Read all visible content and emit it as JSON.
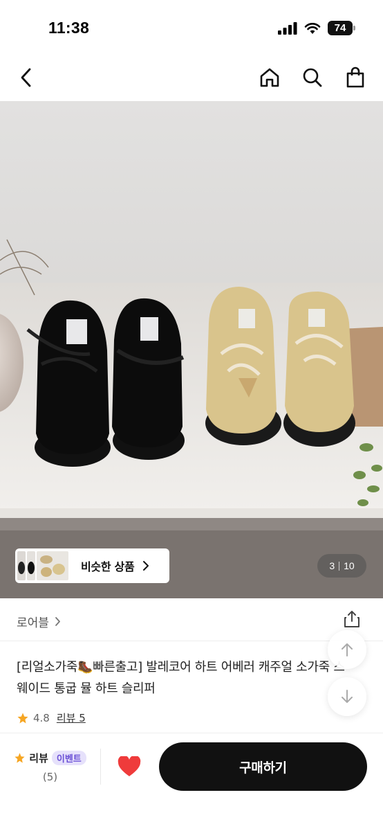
{
  "status": {
    "time": "11:38",
    "battery": "74"
  },
  "nav": {
    "back_icon": "chevron-left-icon",
    "home_icon": "home-icon",
    "search_icon": "search-icon",
    "cart_icon": "shopping-bag-icon"
  },
  "gallery": {
    "similar_label": "비슷한 상품",
    "page_current": "3",
    "page_total": "10"
  },
  "product": {
    "brand": "로어블",
    "title": "[리얼소가죽🥾빠른출고] 발레코어 하트 어베러 캐주얼 소가죽 스웨이드 통굽 뮬 하트 슬리퍼",
    "rating": "4.8",
    "review_link": "리뷰 5"
  },
  "bottom": {
    "review_label": "리뷰",
    "event_badge": "이벤트",
    "review_count": "(5)",
    "buy_label": "구매하기"
  },
  "colors": {
    "accent_heart": "#ef3b3b",
    "star": "#f6a623",
    "buy_button": "#111111",
    "event_badge_bg": "#e6e1fb",
    "event_badge_text": "#6a4fd6"
  }
}
